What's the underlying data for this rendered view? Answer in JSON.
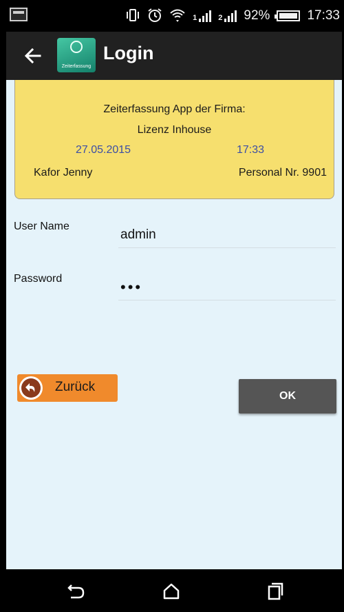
{
  "status_bar": {
    "battery": "92%",
    "time": "17:33",
    "icons": [
      "screenshot-icon",
      "vibrate-icon",
      "alarm-icon",
      "wifi-icon",
      "signal-1-icon",
      "signal-2-icon",
      "battery-icon"
    ],
    "signal_labels": [
      "1",
      "2"
    ]
  },
  "app_bar": {
    "title": "Login",
    "logo_text": "Zeiterfassung"
  },
  "info_card": {
    "line1": "Zeiterfassung App der Firma:",
    "line2": "Lizenz Inhouse",
    "date": "27.05.2015",
    "time": "17:33",
    "name": "Kafor Jenny",
    "personal_nr": "Personal Nr. 9901"
  },
  "form": {
    "username_label": "User Name",
    "username_value": "admin",
    "password_label": "Password",
    "password_value": "•••"
  },
  "buttons": {
    "back_label": "Zurück",
    "ok_label": "OK"
  },
  "colors": {
    "card_bg": "#f6df6e",
    "accent_blue": "#3b4ea6",
    "back_button": "#f08a2c",
    "ok_button": "#555555",
    "content_bg": "#e5f3fa"
  }
}
